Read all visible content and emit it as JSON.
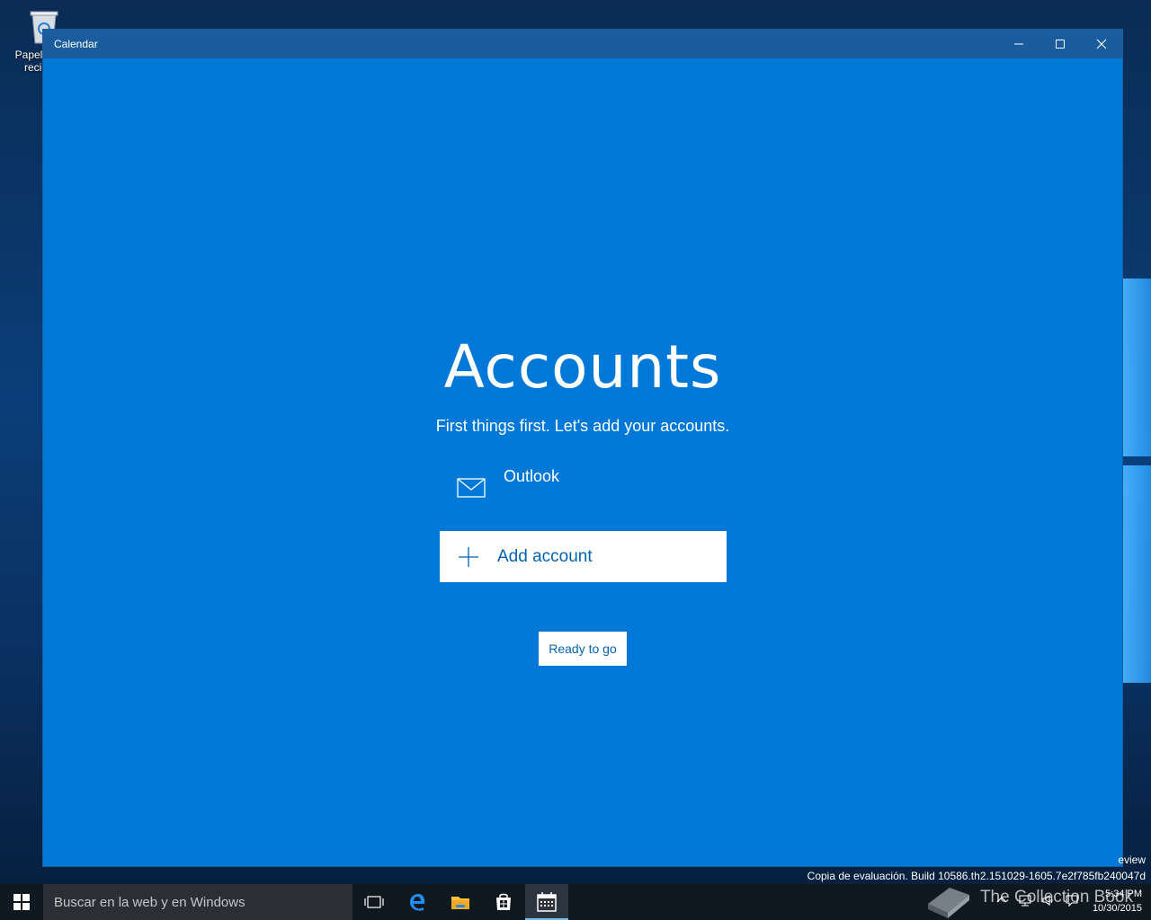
{
  "desktop": {
    "recycle_bin_label": "Papelera de reciclaje",
    "watermark_top": "eview",
    "watermark_build": "Copia de evaluación. Build 10586.th2.151029-1605.7e2f785fb240047d"
  },
  "window": {
    "title": "Calendar",
    "minimize_icon": "minimize-icon",
    "maximize_icon": "maximize-icon",
    "close_icon": "close-icon"
  },
  "accounts": {
    "heading": "Accounts",
    "subtitle": "First things first. Let's add your accounts.",
    "items": [
      {
        "icon": "mail-icon",
        "label": "Outlook"
      }
    ],
    "add_account_label": "Add account",
    "ready_label": "Ready to go"
  },
  "taskbar": {
    "search_placeholder": "Buscar en la web y en Windows",
    "apps": [
      "task-view-icon",
      "edge-icon",
      "file-explorer-icon",
      "store-icon",
      "calendar-icon"
    ],
    "active_app": "calendar-icon",
    "brand_text": "The Collection Book",
    "time": "5:34 PM",
    "date": "10/30/2015"
  },
  "colors": {
    "accent": "#0078d7",
    "titlebar": "#1a5d9e",
    "button_text": "#0063b1",
    "taskbar": "#101820"
  }
}
